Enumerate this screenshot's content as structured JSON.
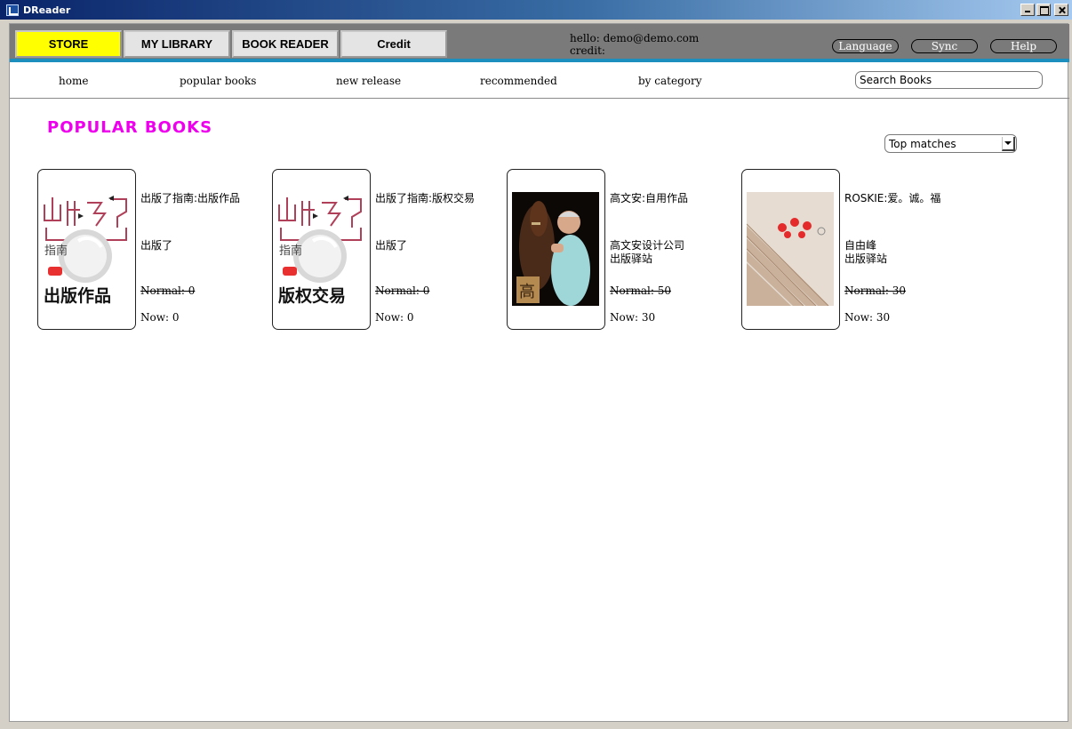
{
  "window": {
    "title": "DReader"
  },
  "header": {
    "tabs": [
      {
        "label": "STORE",
        "active": true
      },
      {
        "label": "MY LIBRARY",
        "active": false
      },
      {
        "label": "BOOK READER",
        "active": false
      },
      {
        "label": "Credit",
        "active": false
      }
    ],
    "hello_line": "hello: demo@demo.com",
    "credit_line": "credit:",
    "buttons": {
      "language": "Language",
      "sync": "Sync",
      "help": "Help"
    }
  },
  "nav": {
    "links": [
      "home",
      "popular books",
      "new release",
      "recommended",
      "by category"
    ],
    "search_placeholder": "Search Books"
  },
  "main": {
    "page_title": "POPULAR BOOKS",
    "sort": {
      "selected": "Top matches"
    },
    "books": [
      {
        "title": "出版了指南:出版作品",
        "publisher": [
          "出版了"
        ],
        "normal": "Normal: 0",
        "now": "Now: 0",
        "cover_text": "出版作品",
        "cover_top": "指南"
      },
      {
        "title": "出版了指南:版权交易",
        "publisher": [
          "出版了"
        ],
        "normal": "Normal: 0",
        "now": "Now: 0",
        "cover_text": "版权交易",
        "cover_top": "指南"
      },
      {
        "title": "高文安:自用作品",
        "publisher": [
          "高文安设计公司",
          "出版驿站"
        ],
        "normal": "Normal: 50",
        "now": "Now: 30",
        "cover_text": "高"
      },
      {
        "title": "ROSKIE:爱。诚。福",
        "publisher": [
          "自由峰",
          "出版驿站"
        ],
        "normal": "Normal: 30",
        "now": "Now: 30"
      }
    ]
  },
  "colors": {
    "active_tab": "#ffff00",
    "page_title": "#ee00ee",
    "header_bg": "#7a7a7a",
    "header_accent": "#1d8fbf",
    "cover_logo": "#b0405a"
  }
}
